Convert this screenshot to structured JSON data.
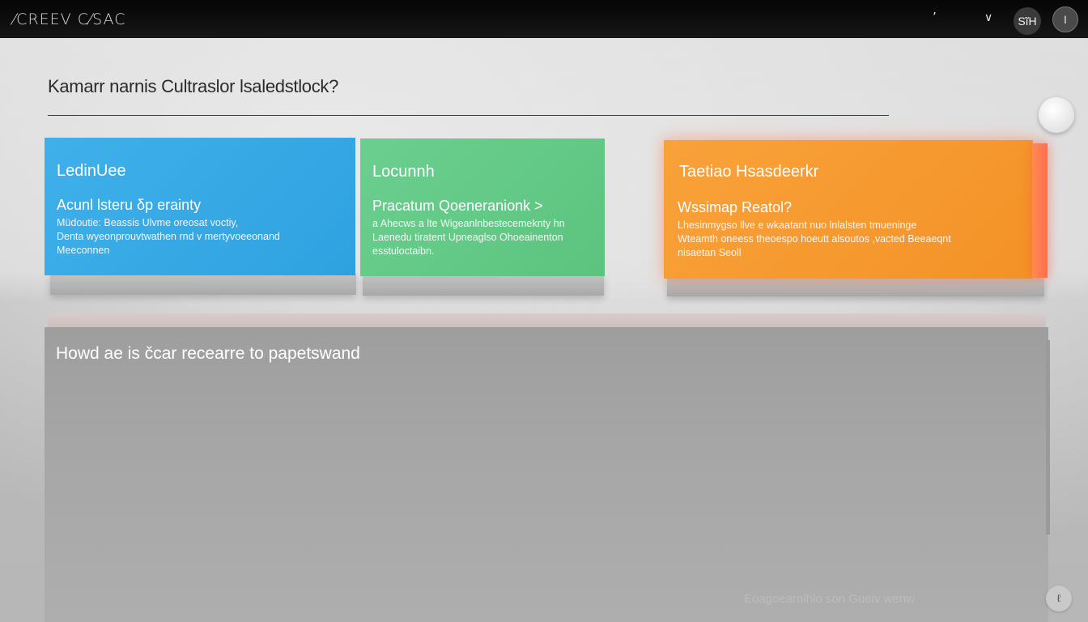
{
  "topbar": {
    "brand": "⁄CREEV C⁄SAC",
    "mark_glyph": "’",
    "chevron_glyph": "∨",
    "user_chip_text": "SĩH",
    "avatar_text": "I"
  },
  "main": {
    "title": "Kamarr narnis  Cultraslor lsaledstlock?"
  },
  "cards": [
    {
      "title": "LedinUee",
      "subtitle": "Acunl lsteru δp erainty",
      "body": [
        "Müdoutie: Beassis Ulvme oreosat voctiy,",
        "Denta  wyeonprouvtwathen rnd v mertyvoeeonand",
        "Meeconnen"
      ]
    },
    {
      "title": "Locunnh",
      "subtitle": "Pracatum Qoeneranionk >",
      "body": [
        "a Ahecws a lte Wigeanlnbestecemeknty hn",
        "Laenedu tiratent Upneaglso Ohoeainenton",
        "esstuloctaibn."
      ]
    },
    {
      "title": "Taetiao Hsasdeerkr",
      "subtitle": "Wssimap Reatol?",
      "body": [
        "Lhesinmygso llve e wkaatant nuo lnlalsten tmueninge",
        "Wteamth oneess theoespo hoeutt alsoutos ,vacted Beeaeqnt",
        "nisaetan Seoll"
      ]
    }
  ],
  "panel": {
    "title": "Howd ae is čcar recearre to papetswand"
  },
  "footer": {
    "text": "Eoagoearnlhlo son Gueiv wenw",
    "corner_button": "ℓ"
  },
  "colors": {
    "card_blue": "#3aaae6",
    "card_green": "#66cb89",
    "card_orange": "#f69a30",
    "orange_glow": "#ff6e4a",
    "topbar": "#0c0c0c"
  },
  "icons": {
    "mark": "mark-icon",
    "chevron": "chevron-down-icon",
    "user_chip": "user-chip",
    "avatar": "avatar-icon",
    "round_button": "circle-button-icon",
    "corner_button": "corner-action-icon"
  }
}
